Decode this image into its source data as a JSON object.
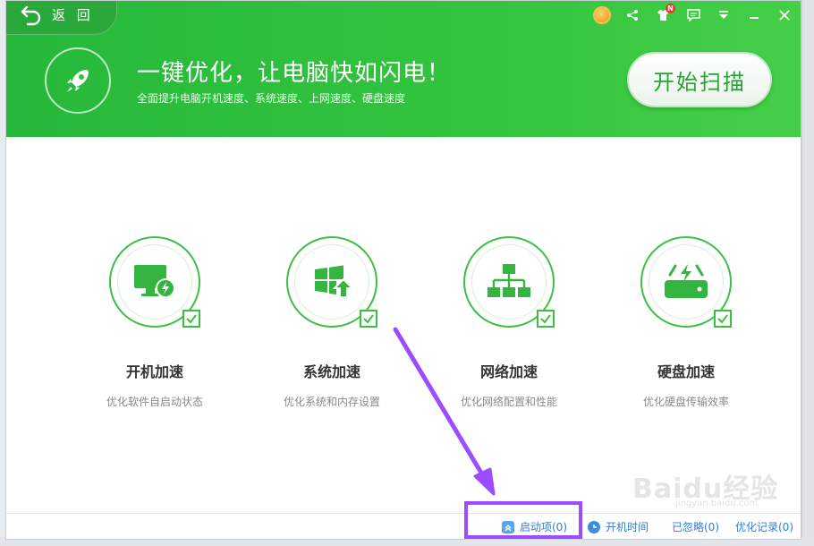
{
  "header": {
    "back_label": "返 回",
    "headline": "一键优化，让电脑快如闪电！",
    "subline": "全面提升电脑开机速度、系统速度、上网速度、硬盘速度",
    "scan_button": "开始扫描",
    "notification_badge": "N",
    "accent_color": "#33c43f"
  },
  "features": [
    {
      "title": "开机加速",
      "desc": "优化软件自启动状态",
      "icon": "monitor-bolt-icon"
    },
    {
      "title": "系统加速",
      "desc": "优化系统和内存设置",
      "icon": "windows-up-icon"
    },
    {
      "title": "网络加速",
      "desc": "优化网络配置和性能",
      "icon": "network-tree-icon"
    },
    {
      "title": "硬盘加速",
      "desc": "优化硬盘传输效率",
      "icon": "disk-bolt-icon"
    }
  ],
  "footer": {
    "startup_items": "启动项(0)",
    "boot_time": "开机时间",
    "ignored": "已忽略(0)",
    "history": "优化记录(0)"
  },
  "watermark": {
    "logo": "Baidu经验",
    "sub": "jingyan.baidu.com"
  },
  "annotation_color": "#9b4dff"
}
